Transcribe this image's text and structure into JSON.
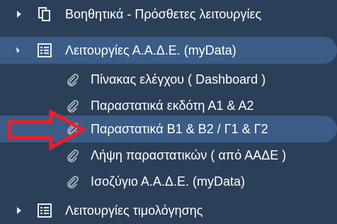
{
  "menu": [
    {
      "label": "Βοηθητικά - Πρόσθετες λειτουργίες",
      "icon": "copy-pages-icon",
      "state": "collapsed"
    },
    {
      "label": "Λειτουργίες Α.Α.Δ.Ε. (myData)",
      "icon": "list-form-icon",
      "state": "expanded",
      "children": [
        {
          "label": "Πίνακας ελέγχου ( Dashboard )",
          "icon": "paperclip-icon"
        },
        {
          "label": "Παραστατικά εκδότη Α1 & Α2",
          "icon": "paperclip-icon"
        },
        {
          "label": "Παραστατικά Β1 & Β2 / Γ1 & Γ2",
          "icon": "paperclip-icon",
          "highlighted": true
        },
        {
          "label": "Λήψη παραστατικών ( από ΑΑΔΕ )",
          "icon": "paperclip-icon"
        },
        {
          "label": "Ισοζύγιο Α.Α.Δ.Ε. (myData)",
          "icon": "paperclip-icon"
        }
      ]
    },
    {
      "label": "Λειτουργίες τιμολόγησης",
      "icon": "list-form-icon",
      "state": "collapsed"
    }
  ],
  "colors": {
    "background": "#2c3f58",
    "highlight": "#3a5c87",
    "arrow": "#e8202a",
    "text": "#ffffff"
  },
  "annotation": {
    "icon": "red-arrow-icon"
  }
}
